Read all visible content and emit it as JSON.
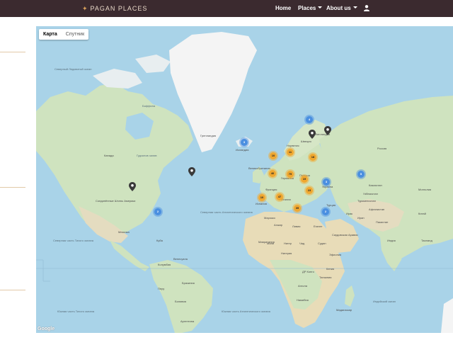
{
  "navbar": {
    "brand": "PAGAN PLACES",
    "items": [
      {
        "label": "Home",
        "dropdown": false
      },
      {
        "label": "Places",
        "dropdown": true
      },
      {
        "label": "About us",
        "dropdown": true
      }
    ],
    "user_icon": "user-icon",
    "colors": {
      "background": "#3b2a2f",
      "brand_text": "#e8d8c8",
      "accent": "#d9a05b"
    }
  },
  "map": {
    "type_buttons": [
      {
        "label": "Карта",
        "active": true
      },
      {
        "label": "Спутник",
        "active": false
      }
    ],
    "attribution": "Google",
    "labels": {
      "greenland": "Гренландия",
      "arctic_ocean": "Северный Ледовитый океан",
      "baffin": "Баффина",
      "hudson": "Гудзонов залив",
      "canada": "Канада",
      "usa": "Соединённые Штаты Америки",
      "mexico": "Мексика",
      "cuba": "Куба",
      "atlantic_north": "Северная часть Атлантического океана",
      "atlantic_south": "Южная часть Атлантического океана",
      "pacific_north": "Северная часть Тихого океана",
      "pacific_south": "Южная часть Тихого океана",
      "indian": "Индийский океан",
      "brazil": "Бразилия",
      "peru": "Перу",
      "bolivia": "Боливия",
      "argentina": "Аргентина",
      "colombia": "Колумбия",
      "venezuela": "Венесуэла",
      "algeria": "Алжир",
      "libya": "Ливия",
      "egypt": "Египет",
      "mali": "Мали",
      "niger": "Нигер",
      "chad": "Чад",
      "sudan": "Судан",
      "nigeria": "Нигерия",
      "ethiopia": "Эфиопия",
      "drc": "ДР Конго",
      "angola": "Ангола",
      "kenya": "Кения",
      "tanzania": "Танзания",
      "namibia": "Намибия",
      "madagascar": "Мадагаскар",
      "mauritania": "Мавритания",
      "morocco": "Марокко",
      "saudi": "Саудовская Аравия",
      "iran": "Иран",
      "iraq": "Ирак",
      "turkey": "Турция",
      "afghanistan": "Афганистан",
      "pakistan": "Пакистан",
      "india": "Индия",
      "china": "Китай",
      "mongolia": "Монголия",
      "kazakhstan": "Казахстан",
      "russia": "Россия",
      "ukraine": "Украина",
      "iceland": "Исландия",
      "norway": "Норвегия",
      "sweden": "Швеция",
      "finland": "Финляндия",
      "uk": "Великобритания",
      "germany": "Германия",
      "france": "Франция",
      "spain": "Испания",
      "italy": "Италия",
      "poland": "Польша",
      "turkmenistan": "Туркменистан",
      "uzbekistan": "Узбекистан",
      "thailand": "Таиланд"
    },
    "clusters": [
      {
        "label": "3",
        "color": "blue"
      },
      {
        "label": "10",
        "color": "orange"
      },
      {
        "label": "11",
        "color": "orange"
      },
      {
        "label": "18",
        "color": "orange"
      },
      {
        "label": "40",
        "color": "orange"
      },
      {
        "label": "75",
        "color": "orange"
      },
      {
        "label": "19",
        "color": "orange"
      },
      {
        "label": "23",
        "color": "orange"
      },
      {
        "label": "10",
        "color": "orange"
      },
      {
        "label": "47",
        "color": "orange"
      },
      {
        "label": "35",
        "color": "orange"
      },
      {
        "label": "4",
        "color": "blue"
      },
      {
        "label": "3",
        "color": "blue"
      },
      {
        "label": "2",
        "color": "blue"
      },
      {
        "label": "2",
        "color": "blue"
      },
      {
        "label": "5",
        "color": "blue"
      }
    ]
  }
}
